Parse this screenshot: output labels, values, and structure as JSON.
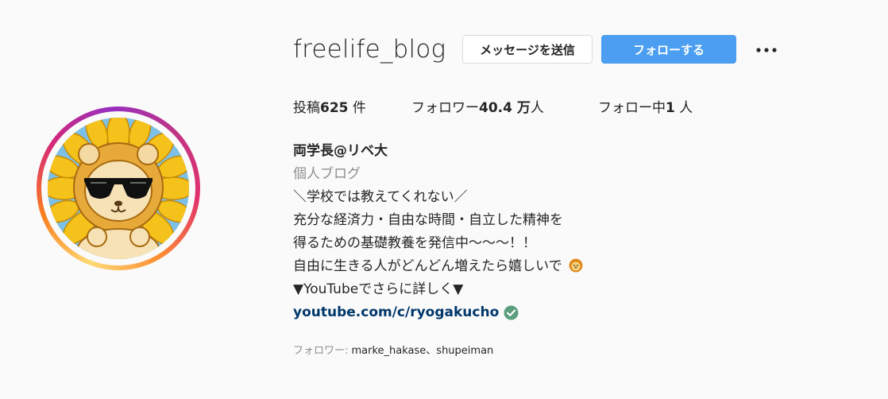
{
  "profile": {
    "username": "freelife_blog",
    "message_button": "メッセージを送信",
    "follow_button": "フォローする",
    "more_icon": "more-options-icon"
  },
  "stats": {
    "posts_label": "投稿",
    "posts_value": "625",
    "posts_unit": " 件",
    "followers_label": "フォロワー",
    "followers_value": "40.4 万",
    "followers_unit": "人",
    "following_label": "フォロー中",
    "following_value": "1",
    "following_unit": " 人"
  },
  "bio": {
    "name": "両学長@リベ大",
    "category": "個人ブログ",
    "lines": [
      "＼学校では教えてくれない／",
      "充分な経済力・自由な時間・自立した精神を",
      "得るための基礎教養を発信中〜〜〜！！",
      "自由に生きる人がどんどん増えたら嬉しいで",
      "▼YouTubeでさらに詳しく▼"
    ],
    "link": "youtube.com/c/ryogakucho"
  },
  "followed_by": {
    "label": "フォロワー: ",
    "users": "marke_hakase、shupeiman"
  },
  "colors": {
    "follow_button": "#4b9ef0",
    "link": "#00376b",
    "verified_badge": "#5a9e7d"
  }
}
